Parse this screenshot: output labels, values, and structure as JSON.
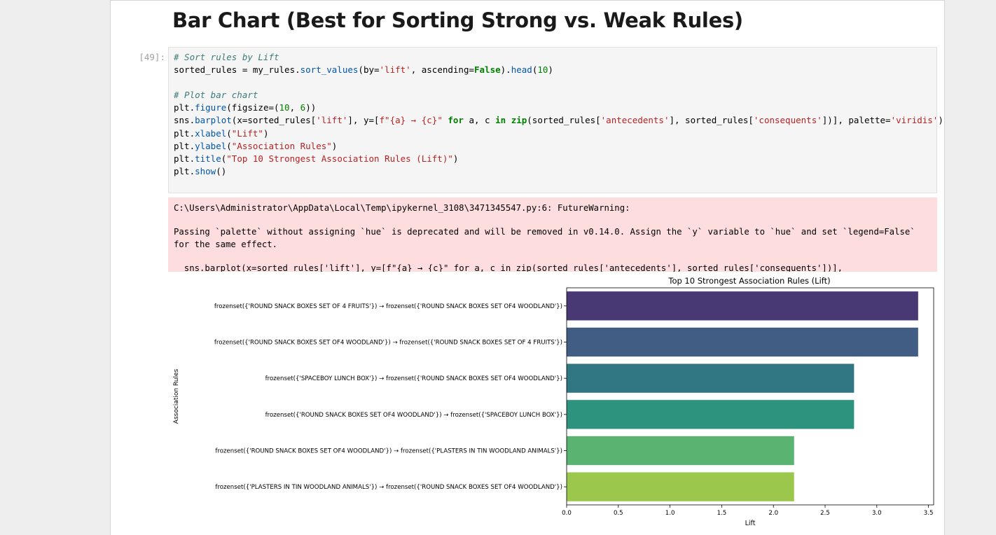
{
  "heading": "Bar Chart (Best for Sorting Strong vs. Weak Rules)",
  "cell": {
    "prompt": "[49]:",
    "code": {
      "l1": "# Sort rules by Lift",
      "l2a": "sorted_rules",
      "l2b": " = my_rules.",
      "l2c": "sort_values",
      "l2d": "(by=",
      "l2e": "'lift'",
      "l2f": ", ascending=",
      "l2g": "False",
      "l2h": ").",
      "l2i": "head",
      "l2j": "(",
      "l2k": "10",
      "l2l": ")",
      "l4": "# Plot bar chart",
      "l5a": "plt.",
      "l5b": "figure",
      "l5c": "(figsize=(",
      "l5d": "10",
      "l5e": ", ",
      "l5f": "6",
      "l5g": "))",
      "l6a": "sns.",
      "l6b": "barplot",
      "l6c": "(x=sorted_rules[",
      "l6d": "'lift'",
      "l6e": "], y=[",
      "l6f": "f\"{a} → {c}\"",
      "l6g": " for",
      "l6h": " a, c ",
      "l6i": "in",
      "l6j": " ",
      "l6k": "zip",
      "l6l": "(sorted_rules[",
      "l6m": "'antecedents'",
      "l6n": "], sorted_rules[",
      "l6o": "'consequents'",
      "l6p": "])], palette=",
      "l6q": "'viridis'",
      "l6r": ")",
      "l7a": "plt.",
      "l7b": "xlabel",
      "l7c": "(",
      "l7d": "\"Lift\"",
      "l7e": ")",
      "l8a": "plt.",
      "l8b": "ylabel",
      "l8c": "(",
      "l8d": "\"Association Rules\"",
      "l8e": ")",
      "l9a": "plt.",
      "l9b": "title",
      "l9c": "(",
      "l9d": "\"Top 10 Strongest Association Rules (Lift)\"",
      "l9e": ")",
      "l10a": "plt.",
      "l10b": "show",
      "l10c": "()"
    }
  },
  "stderr": {
    "path": "C:\\Users\\Administrator\\AppData\\Local\\Temp\\ipykernel_3108\\3471345547.py:6: FutureWarning:",
    "message": "Passing `palette` without assigning `hue` is deprecated and will be removed in v0.14.0. Assign the `y` variable to `hue` and set `legend=False` for the same effect.",
    "source": "  sns.barplot(x=sorted_rules['lift'], y=[f\"{a} → {c}\" for a, c in zip(sorted_rules['antecedents'], sorted_rules['consequents'])], palette='viridis')"
  },
  "chart_data": {
    "type": "bar",
    "orientation": "horizontal",
    "title": "Top 10 Strongest Association Rules (Lift)",
    "xlabel": "Lift",
    "ylabel": "Association Rules",
    "xlim": [
      0,
      3.55
    ],
    "xticks": [
      "0.0",
      "0.5",
      "1.0",
      "1.5",
      "2.0",
      "2.5",
      "3.0",
      "3.5"
    ],
    "grid": false,
    "categories": [
      "frozenset({'ROUND SNACK BOXES SET OF 4 FRUITS'}) → frozenset({'ROUND SNACK BOXES SET OF4 WOODLAND'})",
      "frozenset({'ROUND SNACK BOXES SET OF4 WOODLAND'}) → frozenset({'ROUND SNACK BOXES SET OF 4 FRUITS'})",
      "frozenset({'SPACEBOY LUNCH BOX'}) → frozenset({'ROUND SNACK BOXES SET OF4 WOODLAND'})",
      "frozenset({'ROUND SNACK BOXES SET OF4 WOODLAND'}) → frozenset({'SPACEBOY LUNCH BOX'})",
      "frozenset({'ROUND SNACK BOXES SET OF4 WOODLAND'}) → frozenset({'PLASTERS IN TIN WOODLAND ANIMALS'})",
      "frozenset({'PLASTERS IN TIN WOODLAND ANIMALS'}) → frozenset({'ROUND SNACK BOXES SET OF4 WOODLAND'})"
    ],
    "values": [
      3.4,
      3.4,
      2.78,
      2.78,
      2.2,
      2.2
    ],
    "colors": [
      "#483873",
      "#425d84",
      "#317783",
      "#2e937e",
      "#5ab371",
      "#9ac74c"
    ]
  }
}
